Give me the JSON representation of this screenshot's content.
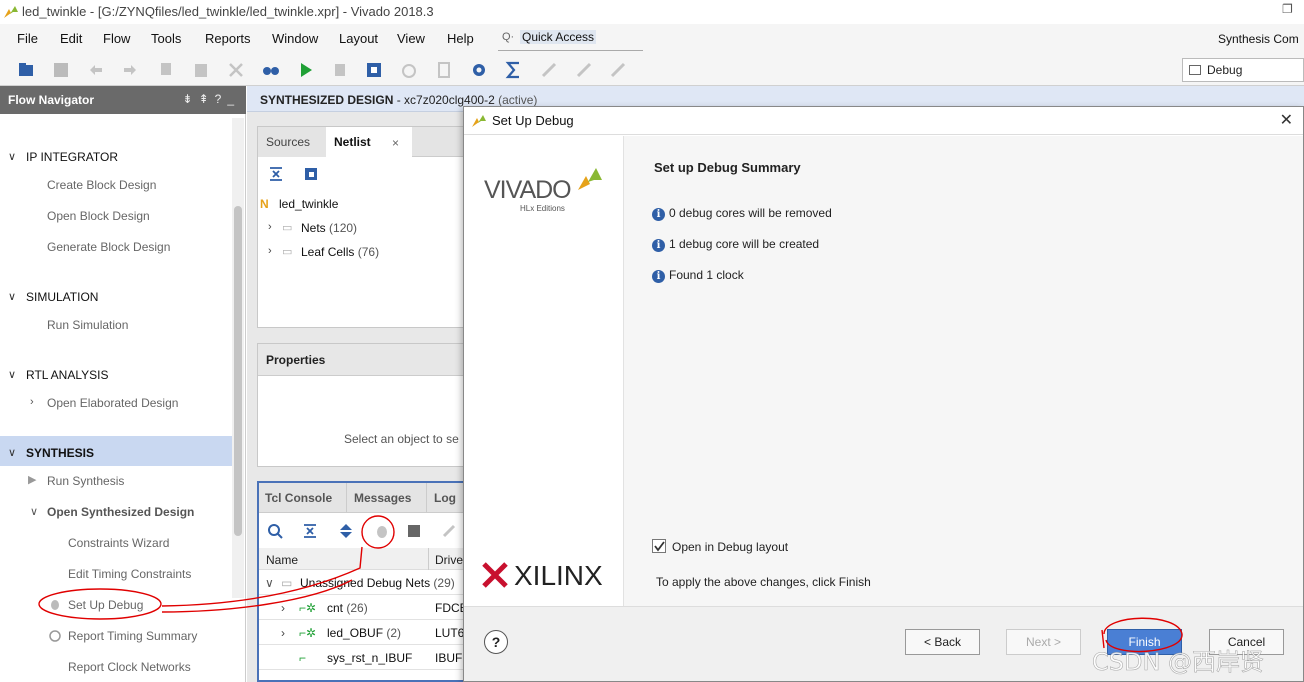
{
  "window": {
    "title": "led_twinkle - [G:/ZYNQfiles/led_twinkle/led_twinkle.xpr] - Vivado 2018.3"
  },
  "menu": [
    "File",
    "Edit",
    "Flow",
    "Tools",
    "Reports",
    "Window",
    "Layout",
    "View",
    "Help"
  ],
  "quick_access": {
    "label": "Quick Access"
  },
  "status": {
    "synthesis": "Synthesis Com"
  },
  "layout_select": {
    "value": "Debug"
  },
  "flow_navigator": {
    "title": "Flow Navigator",
    "sections": [
      {
        "label": "IP INTEGRATOR",
        "items": [
          "Create Block Design",
          "Open Block Design",
          "Generate Block Design"
        ]
      },
      {
        "label": "SIMULATION",
        "items": [
          "Run Simulation"
        ]
      },
      {
        "label": "RTL ANALYSIS",
        "items": [
          "Open Elaborated Design"
        ]
      },
      {
        "label": "SYNTHESIS",
        "items": [
          "Run Synthesis",
          "Open Synthesized Design",
          "Constraints Wizard",
          "Edit Timing Constraints",
          "Set Up Debug",
          "Report Timing Summary",
          "Report Clock Networks"
        ]
      }
    ]
  },
  "design_header": {
    "title": "SYNTHESIZED DESIGN",
    "part": " - xc7z020clg400-2",
    "state": " (active)"
  },
  "sources": {
    "tabs": [
      "Sources",
      "Netlist"
    ],
    "close": "×",
    "root": "led_twinkle",
    "nodes": [
      {
        "label": "Nets",
        "count": "(120)"
      },
      {
        "label": "Leaf Cells",
        "count": "(76)"
      }
    ]
  },
  "properties": {
    "title": "Properties",
    "empty": "Select an object to se"
  },
  "tcl": {
    "tabs": [
      "Tcl Console",
      "Messages",
      "Log"
    ],
    "columns": [
      "Name",
      "Drive"
    ],
    "group": {
      "label": "Unassigned Debug Nets",
      "count": "(29)"
    },
    "rows": [
      {
        "name": "cnt",
        "count": "(26)",
        "driver": "FDCE"
      },
      {
        "name": "led_OBUF",
        "count": "(2)",
        "driver": "LUT6"
      },
      {
        "name": "sys_rst_n_IBUF",
        "count": "",
        "driver": "IBUF"
      }
    ]
  },
  "dialog": {
    "title": "Set Up Debug",
    "summary_title": "Set up Debug Summary",
    "info": [
      "0 debug cores will be removed",
      "1 debug core will be created",
      "Found 1 clock"
    ],
    "checkbox_label": "Open in Debug layout",
    "checkbox_checked": true,
    "apply_note": "To apply the above changes, click Finish",
    "buttons": {
      "help": "?",
      "back": "< Back",
      "next": "Next >",
      "finish": "Finish",
      "cancel": "Cancel"
    },
    "vivado_logo": "VIVADO",
    "vivado_edition": "HLx Editions",
    "xilinx_logo": "XILINX"
  },
  "watermark": "CSDN @西岸贤",
  "colors": {
    "accent": "#4a7fd4",
    "header_band": "#c9d8f1",
    "annotation": "#e00000",
    "logo_green": "#8ab833"
  }
}
